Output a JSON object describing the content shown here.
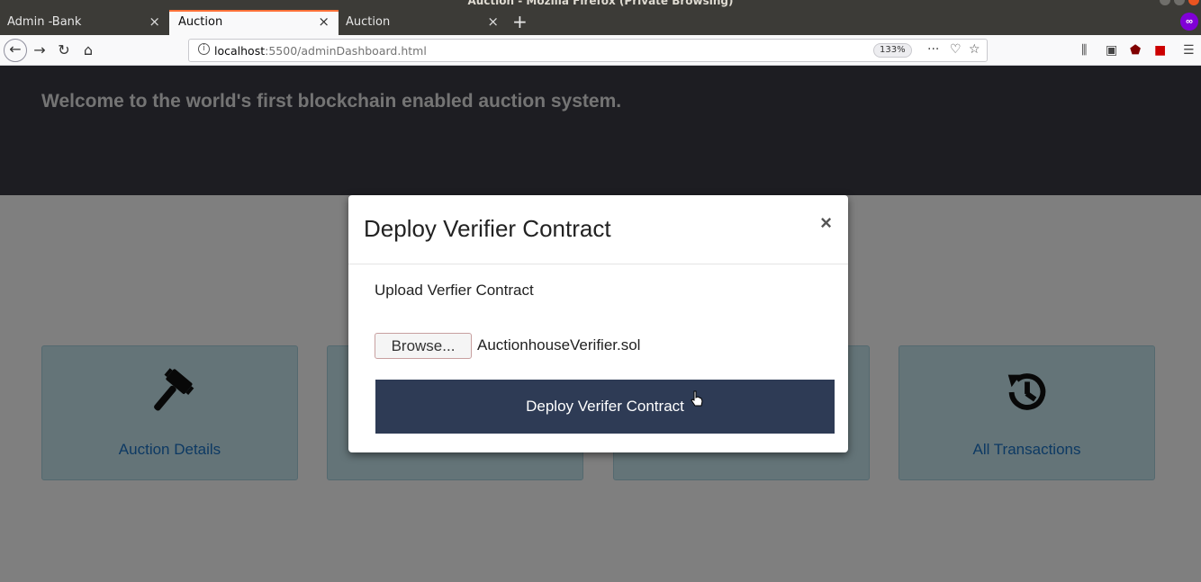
{
  "window": {
    "title": "Auction - Mozilla Firefox (Private Browsing)"
  },
  "tabs": [
    {
      "label": "Admin -Bank",
      "active": false
    },
    {
      "label": "Auction",
      "active": true
    },
    {
      "label": "Auction",
      "active": false
    }
  ],
  "tab_close_glyph": "×",
  "new_tab_glyph": "+",
  "navbar": {
    "url_host": "localhost",
    "url_path": ":5500/adminDashboard.html",
    "zoom": "133%"
  },
  "page": {
    "hero_text": "Welcome to the world's first blockchain enabled auction system.",
    "cards": [
      {
        "label": "Auction Details",
        "icon": "gavel-icon"
      },
      {
        "label": "",
        "icon": ""
      },
      {
        "label": "",
        "icon": ""
      },
      {
        "label": "All Transactions",
        "icon": "history-icon"
      }
    ]
  },
  "modal": {
    "title": "Deploy Verifier Contract",
    "close_glyph": "×",
    "upload_label": "Upload Verfier Contract",
    "browse_label": "Browse...",
    "file_name": "AuctionhouseVerifier.sol",
    "deploy_label": "Deploy Verifer Contract"
  },
  "colors": {
    "accent_tab": "#ff7139",
    "hero_bg": "#3b3b44",
    "card_bg": "#c9e9f1",
    "card_text": "#1a73c6",
    "deploy_bg": "#2e3b55",
    "private_badge": "#8000d7"
  }
}
